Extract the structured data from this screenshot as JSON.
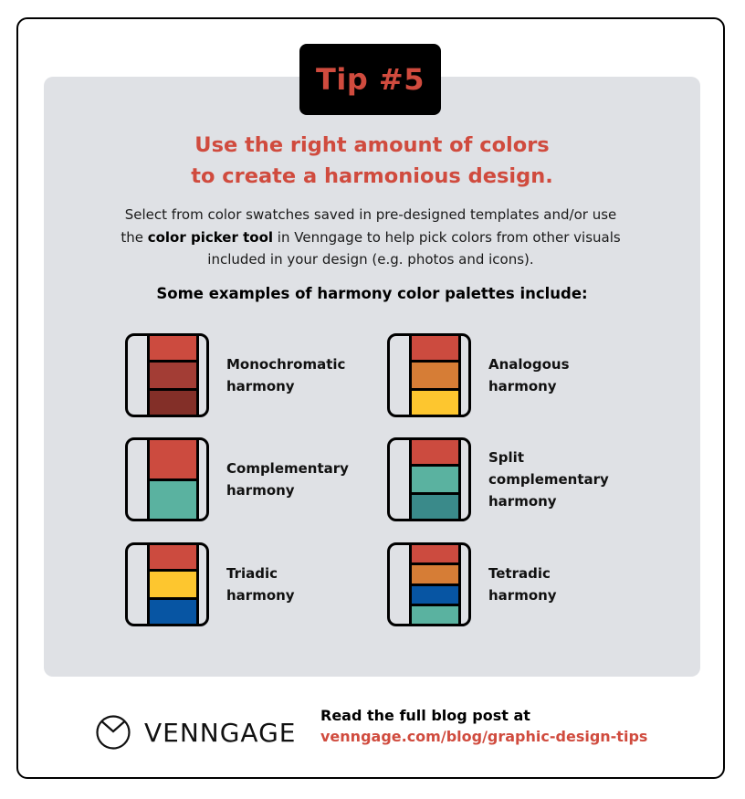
{
  "badge": {
    "label": "Tip #5"
  },
  "headline": {
    "line1": "Use the right amount of colors",
    "line2": "to create a harmonious design."
  },
  "description": {
    "line1": "Select from color swatches saved in pre-designed templates and/or use",
    "line2_pre": "the ",
    "line2_bold": "color picker tool",
    "line2_post": " in Venngage to help pick colors from other visuals",
    "line3": "included in your design (e.g. photos and icons)."
  },
  "subheading": "Some examples of harmony color palettes include:",
  "colors": {
    "accent": "#d04b3e",
    "panel": "#dfe1e5"
  },
  "palettes": [
    {
      "name": "monochromatic",
      "label_lines": [
        "Monochromatic",
        "harmony"
      ],
      "swatches": [
        "#cc4b3f",
        "#a33d35",
        "#832f28"
      ]
    },
    {
      "name": "analogous",
      "label_lines": [
        "Analogous",
        "harmony"
      ],
      "swatches": [
        "#cc4b3f",
        "#d67d36",
        "#fdc62f"
      ]
    },
    {
      "name": "complementary",
      "label_lines": [
        "Complementary",
        "harmony"
      ],
      "swatches": [
        "#cc4b3f",
        "#5ab2a0"
      ]
    },
    {
      "name": "split-complementary",
      "label_lines": [
        "Split",
        "complementary",
        "harmony"
      ],
      "swatches": [
        "#cc4b3f",
        "#5ab2a0",
        "#3a8a8a"
      ]
    },
    {
      "name": "triadic",
      "label_lines": [
        "Triadic",
        "harmony"
      ],
      "swatches": [
        "#cc4b3f",
        "#fdc62f",
        "#0755a3"
      ]
    },
    {
      "name": "tetradic",
      "label_lines": [
        "Tetradic",
        "harmony"
      ],
      "swatches": [
        "#cc4b3f",
        "#d67d36",
        "#0755a3",
        "#5ab2a0"
      ]
    }
  ],
  "footer": {
    "logo_icon": "venngage-logo-icon",
    "logo_text": "VENNGAGE",
    "cta_text": "Read the full blog post at",
    "cta_link": "venngage.com/blog/graphic-design-tips"
  }
}
